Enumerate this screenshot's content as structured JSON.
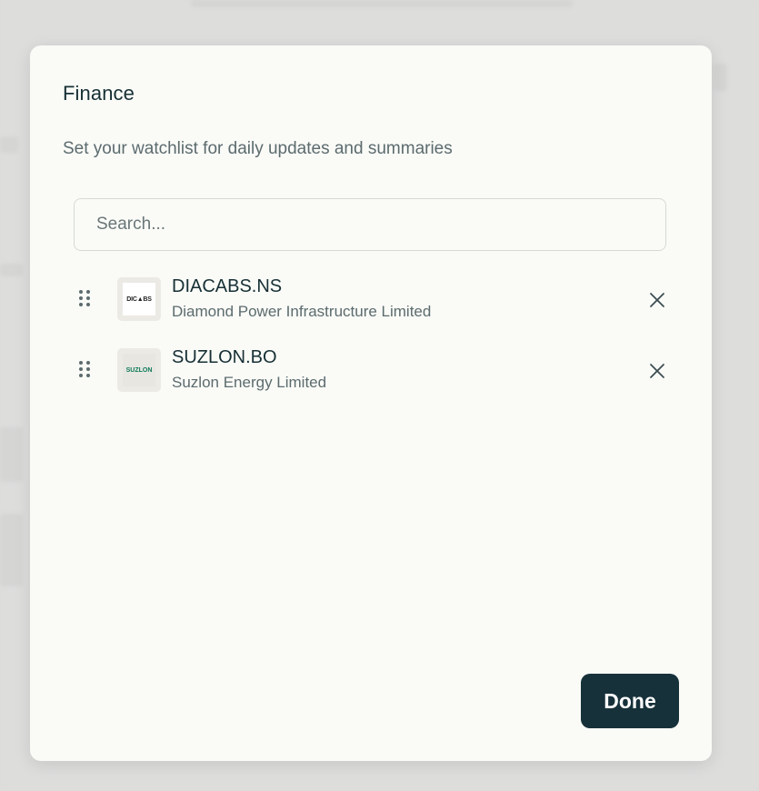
{
  "modal": {
    "title": "Finance",
    "subtitle": "Set your watchlist for daily updates and summaries"
  },
  "search": {
    "placeholder": "Search...",
    "value": ""
  },
  "watchlist": {
    "items": [
      {
        "ticker": "DIACABS.NS",
        "company": "Diamond Power Infrastructure Limited",
        "logo_text": "DIC▲BS",
        "logo_icon": "diacabs-logo-icon"
      },
      {
        "ticker": "SUZLON.BO",
        "company": "Suzlon Energy Limited",
        "logo_text": "SUZLON",
        "logo_icon": "suzlon-logo-icon"
      }
    ]
  },
  "actions": {
    "done_label": "Done"
  },
  "colors": {
    "primary": "#17313a",
    "modal_bg": "#fafbf7",
    "text_primary": "#173035",
    "text_secondary": "#5c6b6e",
    "suzlon_green": "#0d7a5a"
  }
}
